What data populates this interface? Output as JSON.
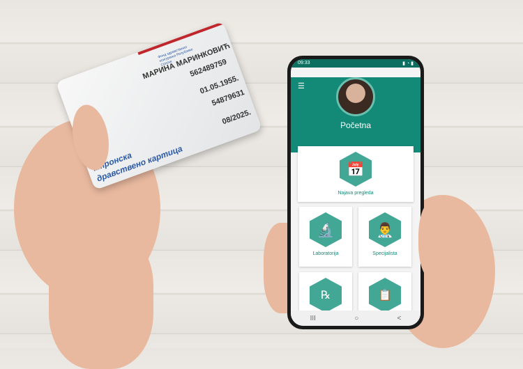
{
  "card": {
    "org": "Фонд здравственог осигурања Републике Српске",
    "name": "МАРИНА МАРИНКОВИЋ",
    "number1": "562489759",
    "dob": "01.05.1955.",
    "number2": "54879631",
    "expiry": "08/2025.",
    "title_line1": "ктронска",
    "title_line2": "дравствено картица"
  },
  "phone": {
    "status": {
      "time": "09:33"
    },
    "header": {
      "title": "Početna"
    },
    "tiles": [
      {
        "label": "Najava pregleda",
        "icon": "calendar-clock-icon"
      },
      {
        "label": "Laboratorija",
        "icon": "microscope-icon"
      },
      {
        "label": "Specijalista",
        "icon": "doctor-icon"
      },
      {
        "label": "",
        "icon": "prescription-icon"
      },
      {
        "label": "",
        "icon": "medical-record-icon"
      }
    ],
    "nav": {
      "recent": "III",
      "home": "○",
      "back": "<"
    }
  },
  "colors": {
    "primary": "#138a77",
    "icon_bg": "#42a895"
  }
}
